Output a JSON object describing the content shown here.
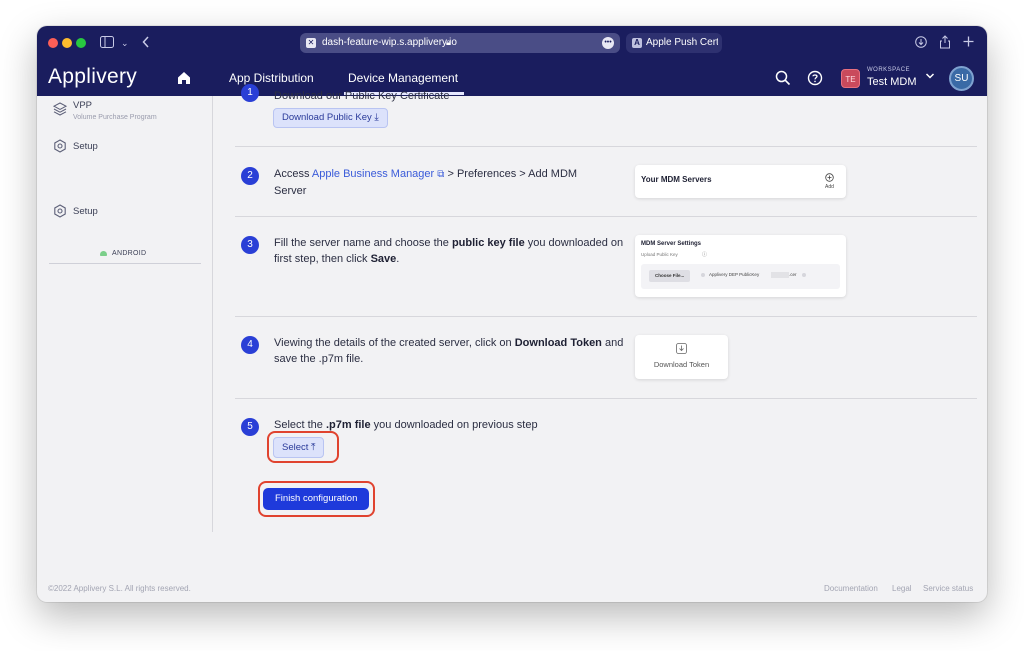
{
  "browser": {
    "url": "dash-feature-wip.s.applivery.io",
    "second_tab": "Apple Push Certif..."
  },
  "header": {
    "logo": "Applivery",
    "nav": [
      "App Distribution",
      "Device Management"
    ],
    "workspace_caption": "WORKSPACE",
    "workspace_badge": "TE",
    "workspace_name": "Test MDM",
    "avatar": "SU"
  },
  "sidebar": {
    "vpp_label": "VPP",
    "vpp_sub": "Volume Purchase Program",
    "setup_ios": "Setup",
    "android_label": "ANDROID",
    "setup_android": "Setup"
  },
  "steps": {
    "step1_partial": "Download our Public Key Certificate",
    "download_key_button": "Download Public Key",
    "s2": {
      "num": "2",
      "pre": "Access ",
      "link": "Apple Business Manager",
      "post": " > Preferences > Add MDM Server"
    },
    "s3": {
      "num": "3",
      "t1": "Fill the server name and choose the ",
      "b1": "public key file",
      "t2": " you downloaded on first step, then click ",
      "b2": "Save",
      "t3": "."
    },
    "s4": {
      "num": "4",
      "t1": "Viewing the details of the created server, click on ",
      "b1": "Download Token",
      "t2": " and save the .p7m file."
    },
    "s5": {
      "num": "5",
      "t1": "Select the ",
      "b1": ".p7m file",
      "t2": " you downloaded on previous step"
    },
    "select_button": "Select",
    "finish_button": "Finish configuration"
  },
  "cards": {
    "servers_title": "Your MDM Servers",
    "servers_add": "Add",
    "settings_title": "MDM Server Settings",
    "settings_label": "Upload Public Key",
    "choose_file": "Choose File...",
    "file_name_start": "Applivery DEP PublicKey",
    "file_name_end": ".cer",
    "token_label": "Download Token"
  },
  "footer": {
    "copyright": "©2022 Applivery S.L. All rights reserved.",
    "links": [
      "Documentation",
      "Legal",
      "Service status"
    ]
  },
  "colors": {
    "header_bg": "#1a1d5e",
    "accent": "#2a3fd6",
    "highlight": "#e0432f"
  }
}
